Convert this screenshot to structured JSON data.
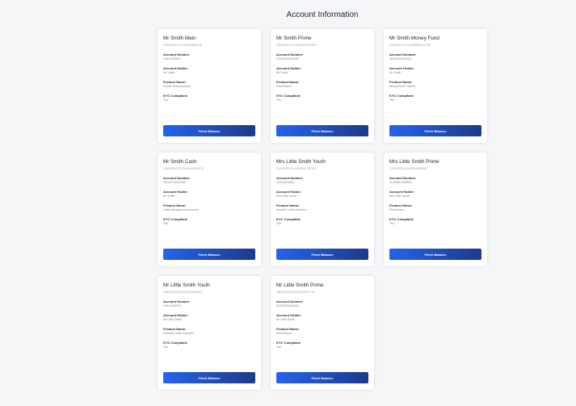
{
  "page": {
    "title": "Account Information"
  },
  "labels": {
    "account_number": "Account Number:",
    "account_holder": "Account Holder:",
    "product_name": "Product Name:",
    "kyc_compliant": "KYC Compliant:",
    "fetch_button": "Fetch Balance"
  },
  "accounts": [
    {
      "name": "Mr Smith Main",
      "id": "335343157471016318858T4E",
      "account_number": "10014425841",
      "holder": "Mr Smith",
      "product": "Private Bank Account",
      "kyc": "Yes"
    },
    {
      "name": "Mr Smith Prime",
      "id": "33534315747101668T8182983",
      "account_number": "11004703231500",
      "holder": "Mr Smith",
      "product": "PrimeSaver",
      "kyc": "Yes"
    },
    {
      "name": "Mr Smith Money Fund",
      "id": "335343157471018998D5101O9",
      "account_number": "11004703231501",
      "holder": "Mr Smith",
      "product": "MoneyFund Tracker",
      "kyc": "Yes"
    },
    {
      "name": "Mr Smith Cash",
      "id": "335343157471016318D281015",
      "account_number": "11004703231540",
      "holder": "Mr Smith",
      "product": "Cash Management Account",
      "kyc": "Yes"
    },
    {
      "name": "Mrs Little Smith Youth",
      "id": "211104787131018396472E782",
      "account_number": "10012024052",
      "holder": "Mrs Little Smith",
      "product": "Investec Youth Account",
      "kyc": "Yes"
    },
    {
      "name": "Mrs Little Smith Prime",
      "id": "211104787131018396825897",
      "account_number": "11005814395500",
      "holder": "Mrs Little Smith",
      "product": "PrimeSaver",
      "kyc": "Yes"
    },
    {
      "name": "Mr Little Smith Youth",
      "id": "388263826321018283050683",
      "account_number": "10011946794",
      "holder": "Mr Little Smith",
      "product": "Investec Youth Account",
      "kyc": "Yes"
    },
    {
      "name": "Mr Little Smith Prime",
      "id": "388263826321018205137740",
      "account_number": "11005794431500",
      "holder": "Mr Little Smith",
      "product": "PrimeSaver",
      "kyc": "Yes"
    }
  ]
}
